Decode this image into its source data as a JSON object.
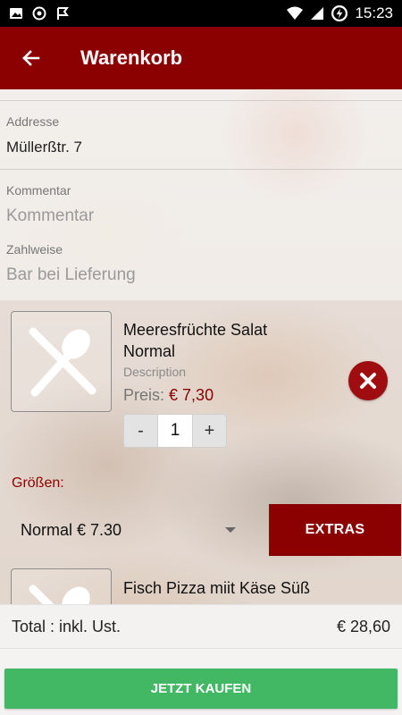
{
  "status_bar": {
    "time": "15:23",
    "icons": [
      "image-icon",
      "record-icon",
      "check-flag-icon",
      "wifi-icon",
      "signal-icon",
      "battery-charging-icon"
    ]
  },
  "app_bar": {
    "title": "Warenkorb",
    "back_icon": "arrow-left-icon",
    "color": "#8b0000"
  },
  "form": {
    "address_label": "Addresse",
    "address_value": "Müllerßtr. 7",
    "comment_label": "Kommentar",
    "comment_placeholder": "Kommentar",
    "payment_label": "Zahlweise",
    "payment_value": "Bar bei Lieferung"
  },
  "cart_items": [
    {
      "name_line1": "Meeresfrüchte Salat",
      "name_line2": "Normal",
      "description": "Description",
      "price_label": "Preis:",
      "price": "€ 7,30",
      "quantity": "1",
      "minus_label": "-",
      "plus_label": "+",
      "image_icon": "fork-spoon-icon",
      "remove_icon": "close-icon",
      "sizes_label": "Größen:",
      "selected_size": "Normal € 7.30",
      "extras_label": "EXTRAS"
    },
    {
      "name_line1": "Fisch Pizza miit Käse Süß",
      "image_icon": "fork-spoon-icon"
    }
  ],
  "total": {
    "label": "Total : inkl. Ust.",
    "amount": "€ 28,60"
  },
  "checkout": {
    "label": "JETZT KAUFEN",
    "color": "#43b864"
  }
}
